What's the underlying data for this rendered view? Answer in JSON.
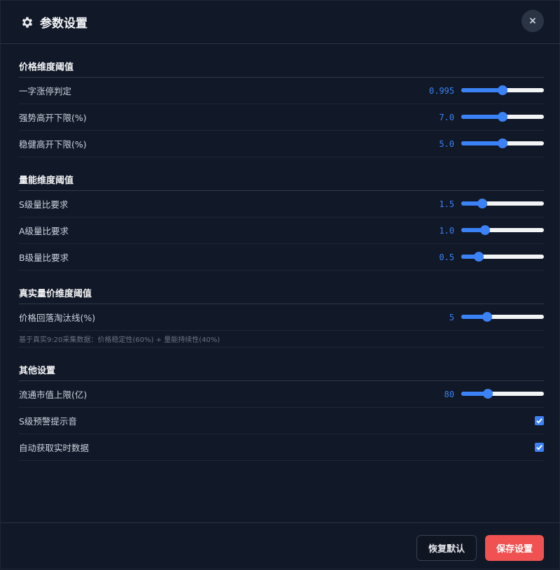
{
  "header": {
    "title": "参数设置",
    "close_label": "×"
  },
  "sections": [
    {
      "title": "价格维度阈值",
      "rows": [
        {
          "label": "一字涨停判定",
          "value": "0.995",
          "fraction": 0.5
        },
        {
          "label": "强势高开下限(%)",
          "value": "7.0",
          "fraction": 0.5
        },
        {
          "label": "稳健高开下限(%)",
          "value": "5.0",
          "fraction": 0.5
        }
      ]
    },
    {
      "title": "量能维度阈值",
      "rows": [
        {
          "label": "S级量比要求",
          "value": "1.5",
          "fraction": 0.25
        },
        {
          "label": "A级量比要求",
          "value": "1.0",
          "fraction": 0.29
        },
        {
          "label": "B级量比要求",
          "value": "0.5",
          "fraction": 0.21
        }
      ]
    },
    {
      "title": "真实量价维度阈值",
      "rows": [
        {
          "label": "价格回落淘汰线(%)",
          "value": "5",
          "fraction": 0.31
        }
      ],
      "note": "基于真实9:20采集数据：价格稳定性(60%) + 量能持续性(40%)"
    },
    {
      "title": "其他设置",
      "rows": [
        {
          "label": "流通市值上限(亿)",
          "value": "80",
          "fraction": 0.32
        }
      ],
      "checks": [
        {
          "label": "S级预警提示音",
          "checked": true
        },
        {
          "label": "自动获取实时数据",
          "checked": true
        }
      ]
    }
  ],
  "footer": {
    "reset_label": "恢复默认",
    "save_label": "保存设置"
  },
  "colors": {
    "accent": "#3b82f6",
    "danger": "#f05252",
    "background": "#111827"
  }
}
